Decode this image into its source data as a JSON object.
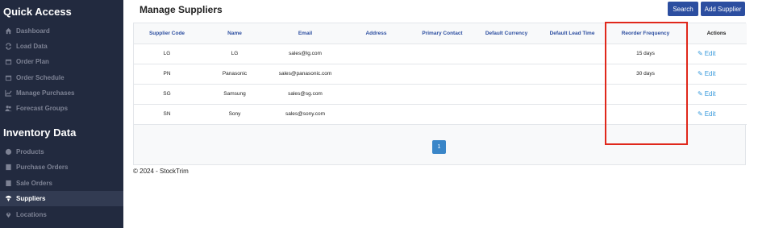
{
  "sidebar": {
    "quick_access_title": "Quick Access",
    "quick_access_items": [
      {
        "label": "Dashboard",
        "icon": "home-icon"
      },
      {
        "label": "Load Data",
        "icon": "sync-icon"
      },
      {
        "label": "Order Plan",
        "icon": "calendar-icon"
      },
      {
        "label": "Order Schedule",
        "icon": "calendar-icon"
      },
      {
        "label": "Manage Purchases",
        "icon": "chart-line-icon"
      },
      {
        "label": "Forecast Groups",
        "icon": "users-icon"
      }
    ],
    "inventory_title": "Inventory Data",
    "inventory_items": [
      {
        "label": "Products",
        "icon": "cube-icon"
      },
      {
        "label": "Purchase Orders",
        "icon": "receipt-icon"
      },
      {
        "label": "Sale Orders",
        "icon": "receipt-icon"
      },
      {
        "label": "Suppliers",
        "icon": "supplier-icon",
        "active": true
      },
      {
        "label": "Locations",
        "icon": "map-marker-icon"
      }
    ]
  },
  "header": {
    "title": "Manage Suppliers",
    "search_label": "Search",
    "add_label": "Add Supplier"
  },
  "table": {
    "columns": [
      "Supplier Code",
      "Name",
      "Email",
      "Address",
      "Primary Contact",
      "Default Currency",
      "Default Lead Time",
      "Reorder Frequency",
      "Actions"
    ],
    "rows": [
      {
        "code": "LG",
        "name": "LG",
        "email": "sales@lg.com",
        "address": "",
        "contact": "",
        "currency": "",
        "lead_time": "",
        "reorder": "15 days",
        "action": "Edit"
      },
      {
        "code": "PN",
        "name": "Panasonic",
        "email": "sales@panasonic.com",
        "address": "",
        "contact": "",
        "currency": "",
        "lead_time": "",
        "reorder": "30 days",
        "action": "Edit"
      },
      {
        "code": "SG",
        "name": "Samsung",
        "email": "sales@sg.com",
        "address": "",
        "contact": "",
        "currency": "",
        "lead_time": "",
        "reorder": "",
        "action": "Edit"
      },
      {
        "code": "SN",
        "name": "Sony",
        "email": "sales@sony.com",
        "address": "",
        "contact": "",
        "currency": "",
        "lead_time": "",
        "reorder": "",
        "action": "Edit"
      }
    ]
  },
  "pagination": {
    "current_page": "1"
  },
  "footer": {
    "text": "© 2024 - StockTrim"
  },
  "colors": {
    "sidebar_bg": "#222a3f",
    "accent": "#2c4ea0",
    "edit_link": "#3498db",
    "highlight": "#e0281b"
  }
}
